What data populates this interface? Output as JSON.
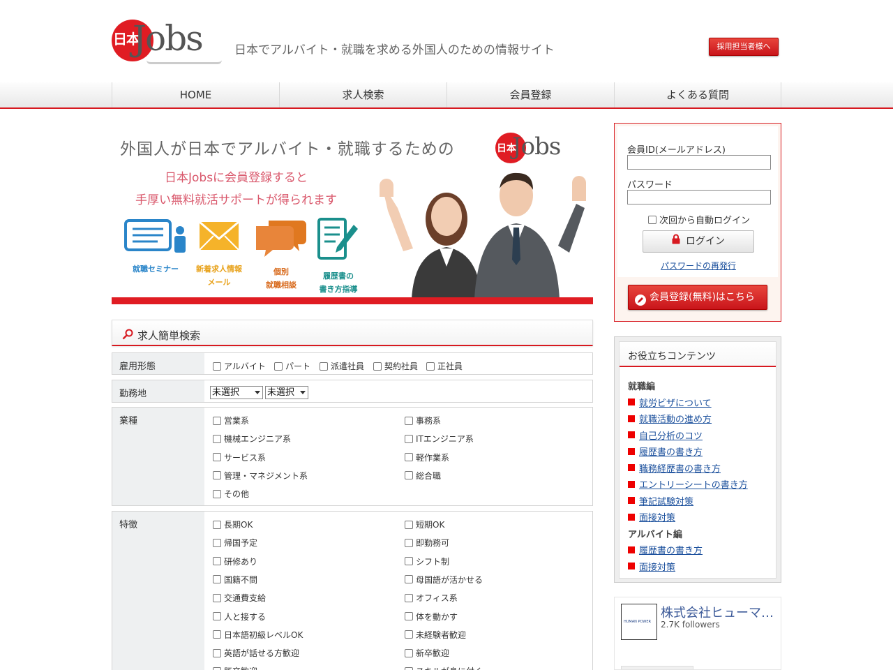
{
  "header": {
    "logo_kanji": "日本",
    "logo_word": "Jobs",
    "tagline": "日本でアルバイト・就職を求める外国人のための情報サイト",
    "recruiter_button": "採用担当者様へ"
  },
  "nav": {
    "items": [
      {
        "label": "HOME"
      },
      {
        "label": "求人検索"
      },
      {
        "label": "会員登録"
      },
      {
        "label": "よくある質問"
      }
    ]
  },
  "banner": {
    "headline": "外国人が日本でアルバイト・就職するための",
    "logo_kanji": "日本",
    "logo_word": "Jobs",
    "sub1": "日本Jobsに会員登録すると",
    "sub2": "手厚い無料就活サポートが得られます",
    "features": [
      {
        "line1": "就職セミナー",
        "line2": ""
      },
      {
        "line1": "新着求人情報",
        "line2": "メール"
      },
      {
        "line1": "個別",
        "line2": "就職相談"
      },
      {
        "line1": "履歴書の",
        "line2": "書き方指導"
      }
    ]
  },
  "search": {
    "title": "求人簡単検索",
    "employment": {
      "label": "雇用形態",
      "options": [
        "アルバイト",
        "パート",
        "派遣社員",
        "契約社員",
        "正社員"
      ]
    },
    "location": {
      "label": "勤務地",
      "select1": "未選択",
      "select2": "未選択"
    },
    "industry": {
      "label": "業種",
      "options": [
        "営業系",
        "事務系",
        "機械エンジニア系",
        "ITエンジニア系",
        "サービス系",
        "軽作業系",
        "管理・マネジメント系",
        "総合職",
        "その他"
      ]
    },
    "features": {
      "label": "特徴",
      "options": [
        "長期OK",
        "短期OK",
        "帰国予定",
        "即勤務可",
        "研修あり",
        "シフト制",
        "国籍不問",
        "母国語が活かせる",
        "交通費支給",
        "オフィス系",
        "人と接する",
        "体を動かす",
        "日本語初級レベルOK",
        "未経験者歓迎",
        "英語が話せる方歓迎",
        "新卒歓迎",
        "既卒歓迎",
        "スキルが身に付く"
      ]
    }
  },
  "login": {
    "id_label": "会員ID(メールアドレス)",
    "password_label": "パスワード",
    "auto_login": "次回から自動ログイン",
    "login_button": "ログイン",
    "reissue_link": "パスワードの再発行",
    "register_button": "会員登録(無料)はこちら"
  },
  "useful": {
    "title": "お役立ちコンテンツ",
    "job_section": "就職編",
    "job_links": [
      "就労ビザについて",
      "就職活動の進め方",
      "自己分析のコツ",
      "履歴書の書き方",
      "職務経歴書の書き方",
      "エントリーシートの書き方",
      "筆記試験対策",
      "面接対策"
    ],
    "part_section": "アルバイト編",
    "part_links": [
      "履歴書の書き方",
      "面接対策"
    ]
  },
  "facebook": {
    "page_name": "株式会社ヒューマンパワー",
    "followers": "2.7K followers",
    "avatar_text": "HUMAN POWER"
  },
  "colors": {
    "brand_red": "#d71920",
    "link_blue": "#1a4f9c"
  }
}
